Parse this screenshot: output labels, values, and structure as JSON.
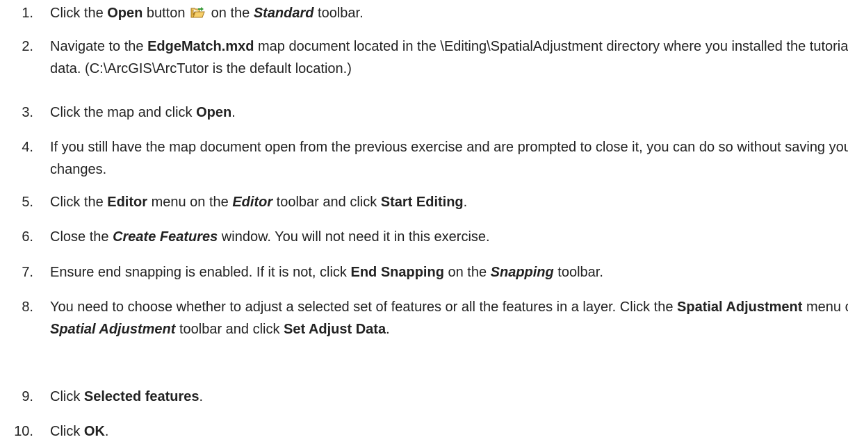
{
  "steps": [
    {
      "num": "1.",
      "parts": [
        {
          "t": "Click the "
        },
        {
          "t": "Open",
          "s": "b"
        },
        {
          "t": " button "
        },
        {
          "icon": "open-folder-icon"
        },
        {
          "t": " on the "
        },
        {
          "t": "Standard",
          "s": "i"
        },
        {
          "t": " toolbar."
        }
      ]
    },
    {
      "num": "2.",
      "parts": [
        {
          "t": "Navigate to the "
        },
        {
          "t": "EdgeMatch.mxd",
          "s": "b"
        },
        {
          "t": " map document located in the \\Editing\\SpatialAdjustment directory where you installed the tutorial data. (C:\\ArcGIS\\ArcTutor is the default location.)"
        }
      ]
    },
    {
      "num": "3.",
      "parts": [
        {
          "t": "Click the map and click "
        },
        {
          "t": "Open",
          "s": "b"
        },
        {
          "t": "."
        }
      ]
    },
    {
      "num": "4.",
      "parts": [
        {
          "t": "If you still have the map document open from the previous exercise and are prompted to close it, you can do so without saving your changes."
        }
      ]
    },
    {
      "num": "5.",
      "parts": [
        {
          "t": "Click the "
        },
        {
          "t": "Editor",
          "s": "b"
        },
        {
          "t": " menu on the "
        },
        {
          "t": "Editor",
          "s": "i"
        },
        {
          "t": " toolbar and click "
        },
        {
          "t": "Start Editing",
          "s": "b"
        },
        {
          "t": "."
        }
      ]
    },
    {
      "num": "6.",
      "parts": [
        {
          "t": "Close the "
        },
        {
          "t": "Create Features",
          "s": "i"
        },
        {
          "t": " window. You will not need it in this exercise."
        }
      ]
    },
    {
      "num": "7.",
      "parts": [
        {
          "t": "Ensure end snapping is enabled. If it is not, click "
        },
        {
          "t": "End Snapping",
          "s": "b"
        },
        {
          "t": " on the "
        },
        {
          "t": "Snapping",
          "s": "i"
        },
        {
          "t": " toolbar."
        }
      ]
    },
    {
      "num": "8.",
      "parts": [
        {
          "t": "You need to choose whether to adjust a selected set of features or all the features in a layer. Click the "
        },
        {
          "t": "Spatial Adjustment",
          "s": "b"
        },
        {
          "t": " menu on the "
        },
        {
          "t": "Spatial Adjustment",
          "s": "i"
        },
        {
          "t": " toolbar and click "
        },
        {
          "t": "Set Adjust Data",
          "s": "b"
        },
        {
          "t": "."
        }
      ]
    },
    {
      "num": "9.",
      "parts": [
        {
          "t": "Click "
        },
        {
          "t": "Selected features",
          "s": "b"
        },
        {
          "t": "."
        }
      ]
    },
    {
      "num": "10.",
      "parts": [
        {
          "t": "Click "
        },
        {
          "t": "OK",
          "s": "b"
        },
        {
          "t": "."
        }
      ]
    }
  ]
}
